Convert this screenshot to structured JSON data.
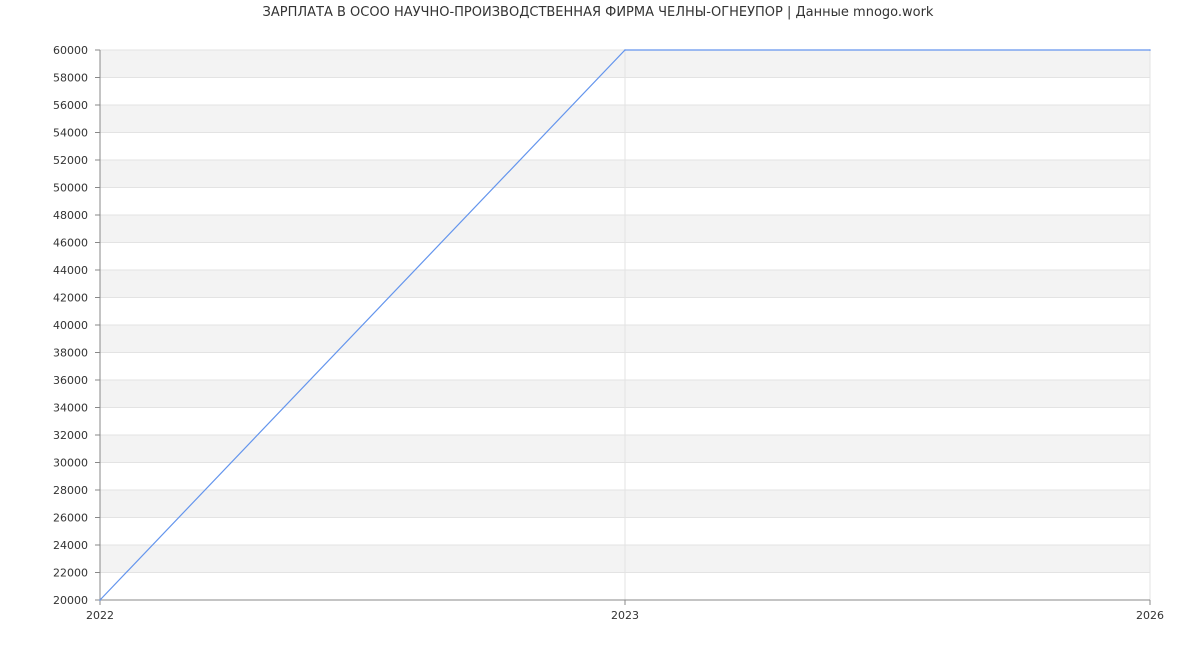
{
  "chart_data": {
    "type": "line",
    "title": "ЗАРПЛАТА В ОСОО НАУЧНО-ПРОИЗВОДСТВЕННАЯ ФИРМА ЧЕЛНЫ-ОГНЕУПОР  | Данные mnogo.work",
    "xlabel": "",
    "ylabel": "",
    "x_ticks": [
      "2022",
      "2023",
      "2026"
    ],
    "ylim": [
      20000,
      60000
    ],
    "y_tick_step": 2000,
    "grid": true,
    "series": [
      {
        "values": [
          20000,
          60000,
          60000
        ],
        "color": "#6495ed"
      }
    ],
    "colors": {
      "band": "#f3f3f3",
      "grid": "#e3e3e3",
      "axis": "#888888",
      "text": "#333333"
    }
  }
}
